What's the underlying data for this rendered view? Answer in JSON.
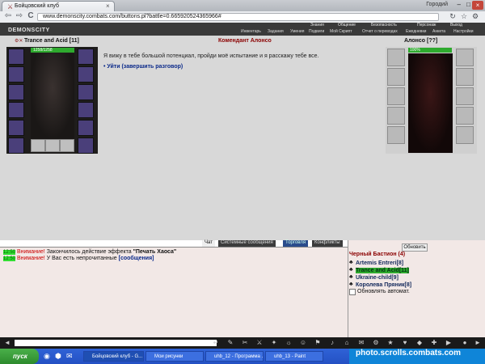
{
  "browser": {
    "tab_title": "Бойцовский клуб",
    "tab_close": "×",
    "user_name": "Городий",
    "window_min": "–",
    "window_max": "□",
    "window_close": "×",
    "url": "www.demonscity.combats.com/buttons.pl?battle=0.665920524365966#",
    "back": "⇦",
    "forward": "⇨",
    "reload": "C"
  },
  "game": {
    "logo": "DEMONSCITY",
    "top_menu": [
      "Знания",
      "Общение",
      "Безопасность",
      "Персонаж",
      "Выход"
    ],
    "sub_menu": [
      "Инвентарь",
      "Задания",
      "Умения",
      "Подвиги",
      "Мой Скрипт",
      "Отчет о переводах",
      "Ежедневки",
      "Анкета",
      "Настройки"
    ],
    "hero": {
      "name": "Trance and Acid",
      "level": "[11]",
      "hp": "1258/1258"
    },
    "npc": {
      "name": "Комендант Алонсо",
      "title": "Алонсо [??]",
      "hp": "100%"
    },
    "dialog": {
      "text": "Я вижу в тебе большой потенциал, пройди моё испытание и я расскажу тебе все.",
      "link": "Уйти (завершить разговор)"
    },
    "chat_tabs": [
      "Чат",
      "Системные сообщения",
      "Торговля",
      "Конфликты"
    ],
    "chat_lines": [
      {
        "time": "12:50",
        "prefix": "Внимание!",
        "text": "Закончилось действие эффекта",
        "bold": "\"Печать Хаоса\""
      },
      {
        "time": "12:50",
        "prefix": "Внимание!",
        "text": "У Вас есть непрочитанные",
        "bold": "[сообщения]"
      }
    ],
    "refresh_button": "Обновить",
    "location": "Черный Бастион (4)",
    "players": [
      {
        "name": "Artemis Entrеri[8]"
      },
      {
        "name": "Trance and Acid[11]"
      },
      {
        "name": "Ukraine-child[9]"
      },
      {
        "name": "Королева Пряник[8]"
      }
    ],
    "auto_refresh": "Обновлять автомат."
  },
  "taskbar": {
    "start": "пуск",
    "tasks": [
      "Бойцовский клуб - G...",
      "Мои рисунки",
      "uhb_12 - Программа ...",
      "uhb_13 - Paint"
    ],
    "watermark": "photo.scrolls.combats.com"
  },
  "colors": {
    "accent": "#8b0000",
    "link": "#0b2a8a",
    "hp": "#2eaa2e"
  }
}
